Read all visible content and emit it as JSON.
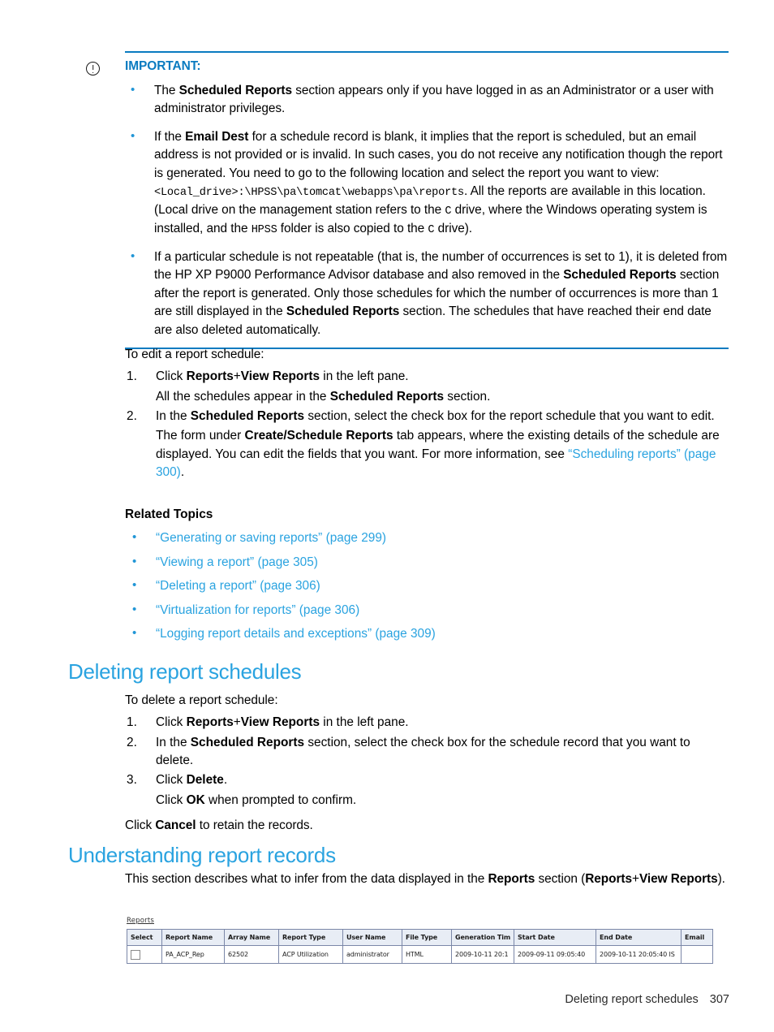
{
  "note": {
    "icon": "important-circle-exclamation-icon",
    "title": "IMPORTANT:",
    "bullets": [
      {
        "parts": [
          {
            "t": "The ",
            "s": "n"
          },
          {
            "t": "Scheduled Reports",
            "s": "b"
          },
          {
            "t": " section appears only if you have logged in as an Administrator or a user with administrator privileges.",
            "s": "n"
          }
        ]
      },
      {
        "parts": [
          {
            "t": "If the ",
            "s": "n"
          },
          {
            "t": "Email Dest",
            "s": "b"
          },
          {
            "t": " for a schedule record is blank, it implies that the report is scheduled, but an email address is not provided or is invalid. In such cases, you do not receive any notification though the report is generated. You need to go to the following location and select the report you want to view: ",
            "s": "n"
          },
          {
            "t": "<Local_drive>:\\HPSS\\pa\\tomcat\\webapps\\pa\\reports",
            "s": "m"
          },
          {
            "t": ". All the reports are available in this location. (Local drive on the management station refers to the ",
            "s": "n"
          },
          {
            "t": "C",
            "s": "m"
          },
          {
            "t": " drive, where the Windows operating system is installed, and the ",
            "s": "n"
          },
          {
            "t": "HPSS",
            "s": "m"
          },
          {
            "t": " folder is also copied to the ",
            "s": "n"
          },
          {
            "t": "C",
            "s": "m"
          },
          {
            "t": " drive).",
            "s": "n"
          }
        ]
      },
      {
        "parts": [
          {
            "t": "If a particular schedule is not repeatable (that is, the number of occurrences is set to 1), it is deleted from the HP XP P9000 Performance Advisor database and also removed in the ",
            "s": "n"
          },
          {
            "t": "Scheduled Reports",
            "s": "b"
          },
          {
            "t": " section after the report is generated. Only those schedules for which the number of occurrences is more than 1 are still displayed in the ",
            "s": "n"
          },
          {
            "t": "Scheduled Reports",
            "s": "b"
          },
          {
            "t": " section. The schedules that have reached their end date are also deleted automatically.",
            "s": "n"
          }
        ]
      }
    ]
  },
  "edit_schedule": {
    "intro": "To edit a report schedule:",
    "steps": [
      {
        "parts": [
          {
            "t": "Click ",
            "s": "n"
          },
          {
            "t": "Reports",
            "s": "b"
          },
          {
            "t": "+",
            "s": "n"
          },
          {
            "t": "View Reports",
            "s": "b"
          },
          {
            "t": " in the left pane.",
            "s": "n"
          }
        ],
        "follow": [
          {
            "parts": [
              {
                "t": "All the schedules appear in the ",
                "s": "n"
              },
              {
                "t": "Scheduled Reports",
                "s": "b"
              },
              {
                "t": " section.",
                "s": "n"
              }
            ]
          }
        ]
      },
      {
        "parts": [
          {
            "t": "In the ",
            "s": "n"
          },
          {
            "t": "Scheduled Reports",
            "s": "b"
          },
          {
            "t": " section, select the check box for the report schedule that you want to edit.",
            "s": "n"
          }
        ],
        "follow": [
          {
            "parts": [
              {
                "t": "The form under ",
                "s": "n"
              },
              {
                "t": "Create/Schedule Reports",
                "s": "b"
              },
              {
                "t": " tab appears, where the existing details of the schedule are displayed. You can edit the fields that you want. For more information, see ",
                "s": "n"
              },
              {
                "t": "“Scheduling reports” (page 300)",
                "s": "x"
              },
              {
                "t": ".",
                "s": "n"
              }
            ]
          }
        ]
      }
    ]
  },
  "related_topics": {
    "heading": "Related Topics",
    "links": [
      "“Generating or saving reports” (page 299)",
      "“Viewing a report” (page 305)",
      "“Deleting a report” (page 306)",
      "“Virtualization for reports” (page 306)",
      "“Logging report details and exceptions” (page 309)"
    ]
  },
  "deleting_section": {
    "heading": "Deleting report schedules",
    "intro": "To delete a report schedule:",
    "steps": [
      {
        "parts": [
          {
            "t": "Click ",
            "s": "n"
          },
          {
            "t": "Reports",
            "s": "b"
          },
          {
            "t": "+",
            "s": "n"
          },
          {
            "t": "View Reports",
            "s": "b"
          },
          {
            "t": " in the left pane.",
            "s": "n"
          }
        ],
        "follow": []
      },
      {
        "parts": [
          {
            "t": "In the ",
            "s": "n"
          },
          {
            "t": "Scheduled Reports",
            "s": "b"
          },
          {
            "t": " section, select the check box for the schedule record that you want to delete.",
            "s": "n"
          }
        ],
        "follow": []
      },
      {
        "parts": [
          {
            "t": "Click ",
            "s": "n"
          },
          {
            "t": "Delete",
            "s": "b"
          },
          {
            "t": ".",
            "s": "n"
          }
        ],
        "follow": [
          {
            "parts": [
              {
                "t": "Click ",
                "s": "n"
              },
              {
                "t": "OK",
                "s": "b"
              },
              {
                "t": " when prompted to confirm.",
                "s": "n"
              }
            ]
          }
        ]
      }
    ],
    "outro": {
      "parts": [
        {
          "t": "Click ",
          "s": "n"
        },
        {
          "t": "Cancel",
          "s": "b"
        },
        {
          "t": " to retain the records.",
          "s": "n"
        }
      ]
    }
  },
  "understanding_section": {
    "heading": "Understanding report records",
    "body": {
      "parts": [
        {
          "t": "This section describes what to infer from the data displayed in the ",
          "s": "n"
        },
        {
          "t": "Reports",
          "s": "b"
        },
        {
          "t": " section (",
          "s": "n"
        },
        {
          "t": "Reports",
          "s": "b"
        },
        {
          "t": "+",
          "s": "n"
        },
        {
          "t": "View Reports",
          "s": "b"
        },
        {
          "t": ").",
          "s": "n"
        }
      ]
    }
  },
  "screenshot": {
    "label": "Reports",
    "columns": [
      "Select",
      "Report Name",
      "Array Name",
      "Report Type",
      "User Name",
      "File Type",
      "Generation Tim",
      "Start Date",
      "End Date",
      "Email"
    ],
    "rows": [
      {
        "select": "",
        "report_name": "PA_ACP_Rep",
        "array_name": "62502",
        "report_type": "ACP Utilization",
        "user_name": "administrator",
        "file_type": "HTML",
        "generation_time": "2009-10-11 20:1",
        "start_date": "2009-09-11 09:05:40",
        "end_date": "2009-10-11 20:05:40 IS",
        "email": ""
      }
    ]
  },
  "footer": {
    "section": "Deleting report schedules",
    "page_number": "307"
  },
  "colors": {
    "accent_blue": "#2aa3e0",
    "rule_blue": "#0a7bc0",
    "bullet_blue": "#2196d6",
    "table_header_bg": "#e8edf5",
    "table_border": "#7b87a8"
  }
}
